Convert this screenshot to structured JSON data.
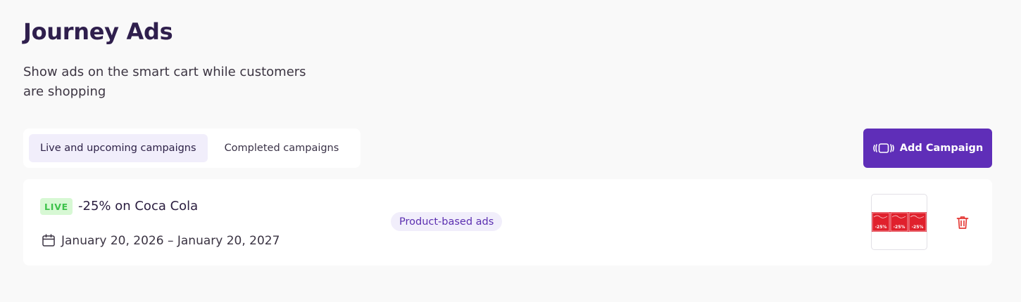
{
  "header": {
    "title": "Journey Ads",
    "subtitle": "Show ads on the smart cart while customers are shopping"
  },
  "tabs": [
    {
      "label": "Live and upcoming campaigns",
      "active": true
    },
    {
      "label": "Completed campaigns",
      "active": false
    }
  ],
  "add_campaign": {
    "label": "Add Campaign",
    "icon": "carousel-icon"
  },
  "campaigns": [
    {
      "status": "LIVE",
      "name": "-25% on Coca Cola",
      "date_range": "January 20, 2026 – January 20, 2027",
      "type": "Product-based ads",
      "thumbnail": {
        "badge_text": "-25%",
        "tiles": 3
      },
      "delete_icon": "trash-icon"
    }
  ],
  "colors": {
    "accent": "#5f2eb8",
    "title": "#2f1f4d",
    "live_bg": "#d7f8d4",
    "live_text": "#3cc24a",
    "tag_bg": "#f1eefb",
    "danger": "#e53935",
    "ad_red": "#e0202c"
  }
}
